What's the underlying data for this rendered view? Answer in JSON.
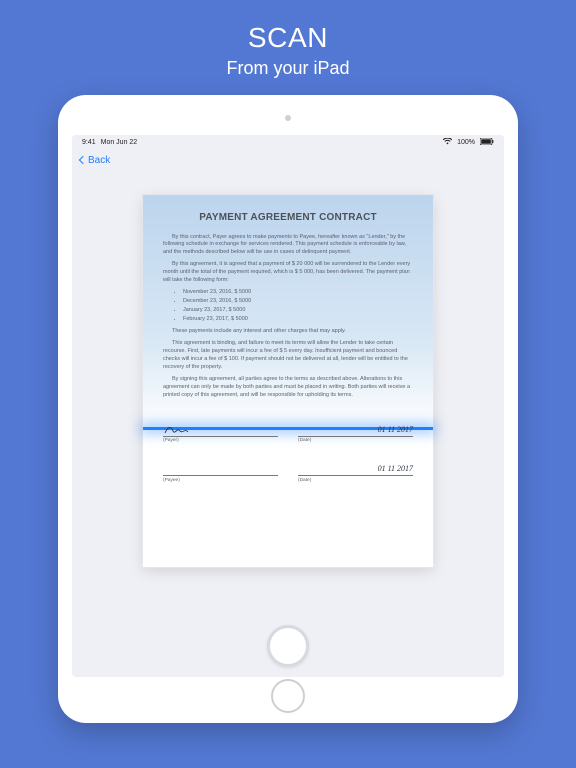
{
  "hero": {
    "title": "SCAN",
    "subtitle": "From your iPad"
  },
  "status": {
    "time": "9:41",
    "date": "Mon Jun 22",
    "wifi": "100%"
  },
  "nav": {
    "back": "Back"
  },
  "doc": {
    "title": "PAYMENT AGREEMENT CONTRACT",
    "p1": "By this contract, Payer agrees to make payments to Payee, hereafter known as \"Lender,\" by the following schedule in exchange for services rendered. This payment schedule is enforceable by law, and the methods described below will be use in cases of delinquent payment.",
    "p2": "By this agreement, it is agreed that a payment of $ 20 000 will be surrendered to the Lender every month until the total of the payment required, which is $ 5 000, has been delivered. The payment plan will take the following form:",
    "items": [
      "November 23, 2016, $ 5000",
      "December 23, 2016, $ 5000",
      "January 23, 2017, $ 5000",
      "February 23, 2017, $ 5000"
    ],
    "p3": "These payments include any interest and other charges that may apply.",
    "p4": "This agreement is binding, and failure to meet its terms will allow the Lender to take certain recourse. First, late payments will incur a fee of $ 5 every day. Insufficient payment and bounced checks will incur a fee of $ 100. If payment should not be delivered at all, lender will be entitled to the recovery of the property.",
    "p5": "By signing this agreement, all parties agree to the terms as described above. Alterations to this agreement can only be made by both parties and must be placed in writing. Both parties will receive a printed copy of this agreement, and will be responsible for upholding its terms.",
    "sig1": {
      "name": "",
      "date": "01 11 2017",
      "labelL": "(Payer)",
      "labelR": "(Date)"
    },
    "sig2": {
      "name": "",
      "date": "01 11 2017",
      "labelL": "(Payee)",
      "labelR": "(Date)"
    }
  }
}
